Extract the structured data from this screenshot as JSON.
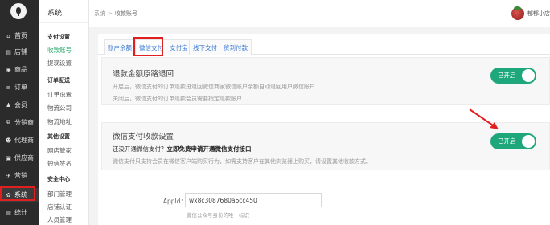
{
  "nav": {
    "items": [
      {
        "icon": "home-icon",
        "glyph": "⌂",
        "label": "首页"
      },
      {
        "icon": "store-icon",
        "glyph": "▤",
        "label": "店铺"
      },
      {
        "icon": "goods-icon",
        "glyph": "◉",
        "label": "商品"
      },
      {
        "icon": "order-icon",
        "glyph": "≡",
        "label": "订单"
      },
      {
        "icon": "member-icon",
        "glyph": "♟",
        "label": "会员"
      },
      {
        "icon": "distribution-icon",
        "glyph": "⧉",
        "label": "分销商"
      },
      {
        "icon": "agent-icon",
        "glyph": "☻",
        "label": "代理商"
      },
      {
        "icon": "supplier-icon",
        "glyph": "▣",
        "label": "供应商"
      },
      {
        "icon": "marketing-icon",
        "glyph": "✈",
        "label": "营销"
      },
      {
        "icon": "settings-icon",
        "glyph": "✿",
        "label": "系统"
      },
      {
        "icon": "stats-icon",
        "glyph": "▥",
        "label": "统计"
      }
    ]
  },
  "submenu": {
    "title": "系统",
    "groups": [
      {
        "label": "支付设置",
        "items": [
          "收款账号",
          "提现设置"
        ]
      },
      {
        "label": "订单配送",
        "items": [
          "订单设置",
          "物流公司",
          "物流地址"
        ]
      },
      {
        "label": "其他设置",
        "items": [
          "网店管家",
          "短信签名"
        ]
      },
      {
        "label": "安全中心",
        "items": [
          "部门管理",
          "店铺认证",
          "人员管理"
        ]
      }
    ]
  },
  "header": {
    "crumb_root": "系统",
    "crumb_sep": ">",
    "crumb_current": "收款账号",
    "username": "郁郁小店"
  },
  "tabs": [
    "账户余额",
    "微信支付",
    "支付宝",
    "线下支付",
    "货到付款"
  ],
  "refund_card": {
    "title": "退款金额原路退回",
    "line1": "开启后，微信支付的订单退款进退回微信商家微信账户余额自动退回用户微信账户",
    "line2": "关闭后，微信支付的订单退款会员需要指定退款账户",
    "toggle": "已开启"
  },
  "wechat_card": {
    "title": "微信支付收款设置",
    "line1_prefix": "还没开通微信支付？",
    "line1_link": "立即免费申请开通微信支付接口",
    "line2": "微信支付只支持会员在微信客户端购买行为，如需支持客户在其他浏览器上购买，请设置其他收款方式。",
    "toggle": "已开启"
  },
  "form": {
    "appid_label": "AppId：",
    "appid_value": "wx8c3087680a6cc450",
    "appid_help": "微信公众号身份的唯一标识"
  },
  "colors": {
    "accent_green": "#1fa77c",
    "nav_bg": "#2b2b2b",
    "annotation_red": "#e02020",
    "link_blue": "#3a7bd5"
  }
}
